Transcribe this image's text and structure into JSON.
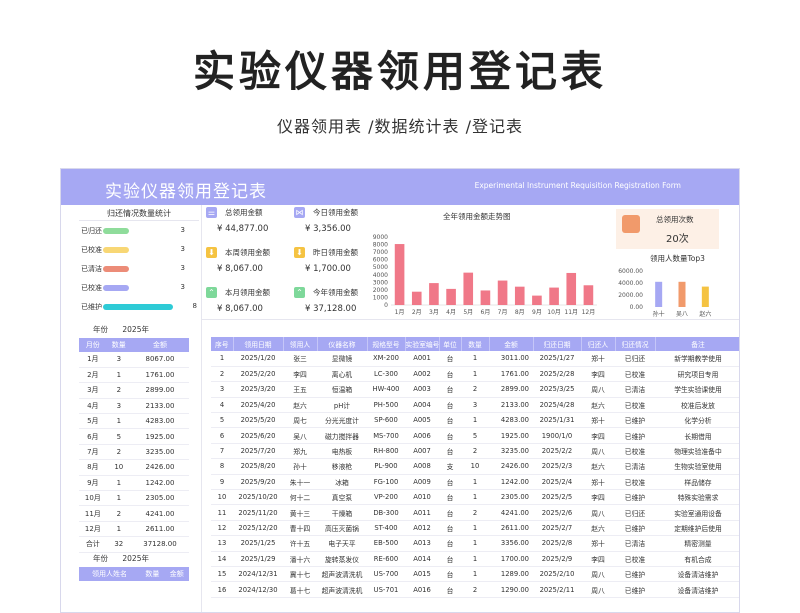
{
  "hero": {
    "title": "实验仪器领用登记表",
    "subtitle": "仪器领用表 /数据统计表 /登记表"
  },
  "banner": {
    "title": "实验仪器领用登记表",
    "en": "Experimental Instrument Requisition Registration Form",
    "color": "#a6a8f3"
  },
  "status": {
    "title": "归还情况数量统计",
    "items": [
      {
        "label": "已归还",
        "value": "3",
        "color": "#8fdc9b",
        "fraction": 0.375
      },
      {
        "label": "已校准",
        "value": "3",
        "color": "#f8d775",
        "fraction": 0.375
      },
      {
        "label": "已清洁",
        "value": "3",
        "color": "#ec8c78",
        "fraction": 0.375
      },
      {
        "label": "已校准",
        "value": "3",
        "color": "#a6a8f3",
        "fraction": 0.375
      },
      {
        "label": "已维护",
        "value": "8",
        "color": "#2ecbd6",
        "fraction": 1.0
      }
    ]
  },
  "monthly": {
    "year_label": "年份",
    "year": "2025年",
    "headers": [
      "月份",
      "数量",
      "金额"
    ],
    "rows": [
      [
        "1月",
        "3",
        "8067.00"
      ],
      [
        "2月",
        "1",
        "1761.00"
      ],
      [
        "3月",
        "2",
        "2899.00"
      ],
      [
        "4月",
        "3",
        "2133.00"
      ],
      [
        "5月",
        "1",
        "4283.00"
      ],
      [
        "6月",
        "5",
        "1925.00"
      ],
      [
        "7月",
        "2",
        "3235.00"
      ],
      [
        "8月",
        "10",
        "2426.00"
      ],
      [
        "9月",
        "1",
        "1242.00"
      ],
      [
        "10月",
        "1",
        "2305.00"
      ],
      [
        "11月",
        "2",
        "4241.00"
      ],
      [
        "12月",
        "1",
        "2611.00"
      ],
      [
        "合计",
        "32",
        "37128.00"
      ]
    ]
  },
  "person": {
    "year_label": "年份",
    "year": "2025年",
    "headers": [
      "领用人姓名",
      "数量",
      "金额"
    ]
  },
  "kpis": [
    {
      "label": "总领用金额",
      "value": "¥ 44,877.00",
      "icon": "sliders-icon",
      "color": "#a6a8f3"
    },
    {
      "label": "今日领用金额",
      "value": "¥ 3,356.00",
      "icon": "share-icon",
      "color": "#a6a8f3"
    },
    {
      "label": "本周领用金额",
      "value": "¥ 8,067.00",
      "icon": "download-icon",
      "color": "#f5c342"
    },
    {
      "label": "昨日领用金额",
      "value": "¥ 1,700.00",
      "icon": "download-icon",
      "color": "#f5c342"
    },
    {
      "label": "本月领用金额",
      "value": "¥ 8,067.00",
      "icon": "chevrons-up-icon",
      "color": "#7ed89a"
    },
    {
      "label": "今年领用金额",
      "value": "¥ 37,128.00",
      "icon": "chevrons-up-icon",
      "color": "#7ed89a"
    }
  ],
  "count_card": {
    "label": "总领用次数",
    "value": "20次"
  },
  "top3_title": "领用人数量Top3",
  "chart_data": [
    {
      "type": "bar",
      "title": "全年领用金额走势图",
      "categories": [
        "1月",
        "2月",
        "3月",
        "4月",
        "5月",
        "6月",
        "7月",
        "8月",
        "9月",
        "10月",
        "11月",
        "12月"
      ],
      "values": [
        8067,
        1761,
        2899,
        2133,
        4283,
        1925,
        3235,
        2426,
        1242,
        2305,
        4241,
        2611
      ],
      "ylim": [
        0,
        9000
      ],
      "yticks": [
        "0",
        "1000",
        "2000",
        "3000",
        "4000",
        "5000",
        "6000",
        "7000",
        "8000",
        "9000"
      ],
      "color": "#f07888"
    },
    {
      "type": "bar",
      "title": "领用人数量Top3",
      "categories": [
        "孙十",
        "吴八",
        "赵六"
      ],
      "values": [
        4200,
        4200,
        3400
      ],
      "ylim": [
        0,
        6000
      ],
      "yticks": [
        "0.00",
        "2000.00",
        "4000.00",
        "6000.00"
      ],
      "colors": [
        "#a6a8f3",
        "#f19a6b",
        "#f5c342"
      ]
    }
  ],
  "main": {
    "headers": [
      "序号",
      "领用日期",
      "领用人",
      "仪器名称",
      "规格型号",
      "实验室编号",
      "单位",
      "数量",
      "金额",
      "归还日期",
      "归还人",
      "归还情况",
      "备注"
    ],
    "rows": [
      [
        "1",
        "2025/1/20",
        "张三",
        "显微镜",
        "XM-200",
        "A001",
        "台",
        "1",
        "3011.00",
        "2025/1/27",
        "郑十",
        "已归还",
        "新学期教学使用"
      ],
      [
        "2",
        "2025/2/20",
        "李四",
        "离心机",
        "LC-300",
        "A002",
        "台",
        "1",
        "1761.00",
        "2025/2/28",
        "李四",
        "已校准",
        "研究项目专用"
      ],
      [
        "3",
        "2025/3/20",
        "王五",
        "恒温箱",
        "HW-400",
        "A003",
        "台",
        "2",
        "2899.00",
        "2025/3/25",
        "周八",
        "已清洁",
        "学生实验课使用"
      ],
      [
        "4",
        "2025/4/20",
        "赵六",
        "pH计",
        "PH-500",
        "A004",
        "台",
        "3",
        "2133.00",
        "2025/4/28",
        "赵六",
        "已校准",
        "校准后发放"
      ],
      [
        "5",
        "2025/5/20",
        "周七",
        "分光光度计",
        "SP-600",
        "A005",
        "台",
        "1",
        "4283.00",
        "2025/1/31",
        "郑十",
        "已维护",
        "化学分析"
      ],
      [
        "6",
        "2025/6/20",
        "吴八",
        "磁力搅拌器",
        "MS-700",
        "A006",
        "台",
        "5",
        "1925.00",
        "1900/1/0",
        "李四",
        "已维护",
        "长期借用"
      ],
      [
        "7",
        "2025/7/20",
        "郑九",
        "电热板",
        "RH-800",
        "A007",
        "台",
        "2",
        "3235.00",
        "2025/2/2",
        "周八",
        "已校准",
        "物理实验准备中"
      ],
      [
        "8",
        "2025/8/20",
        "孙十",
        "移液枪",
        "PL-900",
        "A008",
        "支",
        "10",
        "2426.00",
        "2025/2/3",
        "赵六",
        "已清洁",
        "生物实验室使用"
      ],
      [
        "9",
        "2025/9/20",
        "朱十一",
        "冰箱",
        "FG-100",
        "A009",
        "台",
        "1",
        "1242.00",
        "2025/2/4",
        "郑十",
        "已校准",
        "样品储存"
      ],
      [
        "10",
        "2025/10/20",
        "何十二",
        "真空泵",
        "VP-200",
        "A010",
        "台",
        "1",
        "2305.00",
        "2025/2/5",
        "李四",
        "已维护",
        "特殊实验需求"
      ],
      [
        "11",
        "2025/11/20",
        "黄十三",
        "干燥箱",
        "DB-300",
        "A011",
        "台",
        "2",
        "4241.00",
        "2025/2/6",
        "周八",
        "已归还",
        "实验室通用设备"
      ],
      [
        "12",
        "2025/12/20",
        "曹十四",
        "高压灭菌锅",
        "ST-400",
        "A012",
        "台",
        "1",
        "2611.00",
        "2025/2/7",
        "赵六",
        "已维护",
        "定期维护后使用"
      ],
      [
        "13",
        "2025/1/25",
        "许十五",
        "电子天平",
        "EB-500",
        "A013",
        "台",
        "1",
        "3356.00",
        "2025/2/8",
        "郑十",
        "已清洁",
        "精密测量"
      ],
      [
        "14",
        "2025/1/29",
        "潘十六",
        "旋转蒸发仪",
        "RE-600",
        "A014",
        "台",
        "1",
        "1700.00",
        "2025/2/9",
        "李四",
        "已校准",
        "有机合成"
      ],
      [
        "15",
        "2024/12/31",
        "冀十七",
        "超声波清洗机",
        "US-700",
        "A015",
        "台",
        "1",
        "1289.00",
        "2025/2/10",
        "周八",
        "已维护",
        "设备清洁维护"
      ],
      [
        "16",
        "2024/12/30",
        "葛十七",
        "超声波清洗机",
        "US-701",
        "A016",
        "台",
        "2",
        "1290.00",
        "2025/2/11",
        "周八",
        "已维护",
        "设备清洁维护"
      ]
    ]
  }
}
